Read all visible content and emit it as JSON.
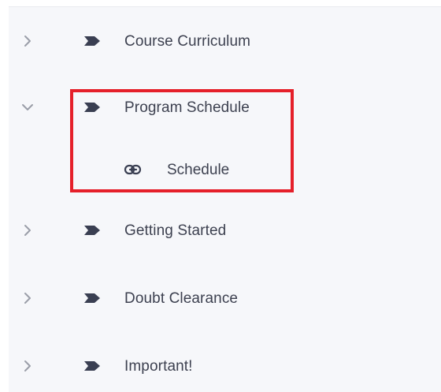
{
  "sections": [
    {
      "label": "Course Curriculum",
      "expanded": false,
      "icon": "chevron-right-icon"
    },
    {
      "label": "Program Schedule",
      "expanded": true,
      "icon": "chevron-down-icon",
      "children": [
        {
          "label": "Schedule",
          "icon": "link-icon"
        }
      ]
    },
    {
      "label": "Getting Started",
      "expanded": false,
      "icon": "chevron-right-icon"
    },
    {
      "label": "Doubt Clearance",
      "expanded": false,
      "icon": "chevron-right-icon"
    },
    {
      "label": "Important!",
      "expanded": false,
      "icon": "chevron-right-icon"
    }
  ],
  "colors": {
    "panel_background": "#f6f7fa",
    "text": "#3d4150",
    "chevron": "#9a9ea8",
    "section_icon": "#3a3f52",
    "highlight_border": "#e5202a"
  }
}
